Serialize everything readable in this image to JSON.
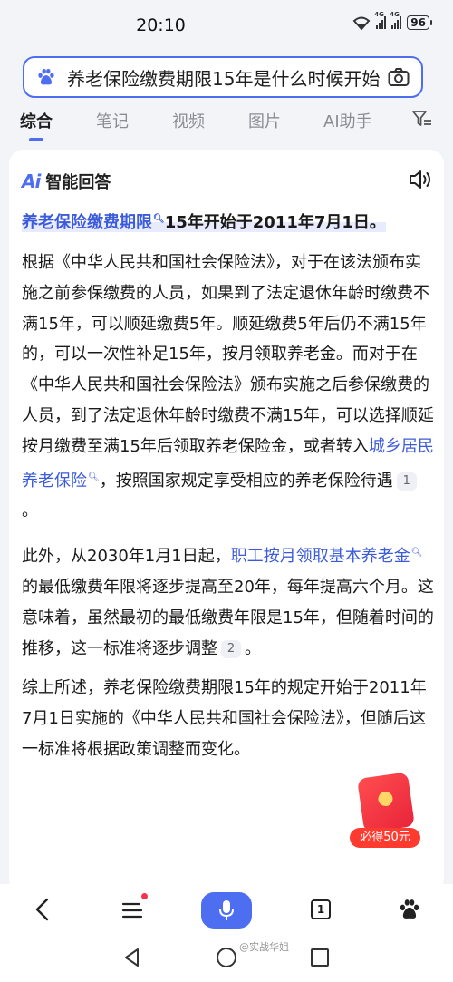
{
  "status_bar": {
    "time": "20:10",
    "signal1_tag": "4G",
    "signal2_tag": "4G",
    "battery": "96"
  },
  "search": {
    "query": "养老保险缴费期限15年是什么时候开始"
  },
  "tabs": [
    "综合",
    "笔记",
    "视频",
    "图片",
    "AI助手"
  ],
  "ai_answer": {
    "logo": "Ai",
    "title": "智能回答",
    "lead_link": "养老保险缴费期限",
    "lead_text": "15年开始于2011年7月1日。",
    "para1_a": "根据《中华人民共和国社会保险法》，对于在该法颁布实施之前参保缴费的人员，如果到了法定退休年龄时缴费不满15年，可以顺延缴费5年。顺延缴费5年后仍不满15年的，可以一次性补足15年，按月领取养老金。而对于在《中华人民共和国社会保险法》颁布实施之后参保缴费的人员，到了法定退休年龄时缴费不满15年，可以选择顺延按月缴费至满15年后领取养老保险金，或者转入",
    "para1_link": "城乡居民养老保险",
    "para1_b": "，按照国家规定享受相应的养老保险待遇",
    "para1_ref": "1",
    "para1_end": "。",
    "para2_a": "此外，从2030年1月1日起，",
    "para2_link": "职工按月领取基本养老金",
    "para2_b": "的最低缴费年限将逐步提高至20年，每年提高六个月。这意味着，虽然最初的最低缴费年限是15年，但随着时间的推移，这一标准将逐步调整",
    "para2_ref": "2",
    "para2_end": "。",
    "para3": "综上所述，养老保险缴费期限15年的规定开始于2011年7月1日实施的《中华人民共和国社会保险法》，但随后这一标准将根据政策调整而变化。"
  },
  "red_packet": {
    "label": "必得50元"
  },
  "toolbar": {
    "pages_count": "1"
  },
  "watermark": "@实战华姐",
  "colors": {
    "accent": "#4e6ef2",
    "link": "#3b5bdb",
    "badge_red": "#ff3b30"
  }
}
